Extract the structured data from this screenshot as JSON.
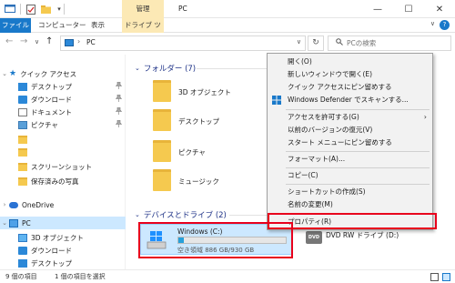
{
  "titlebar": {
    "manage_label": "管理",
    "title": "PC",
    "minimize": "—",
    "maximize": "☐",
    "close": "✕"
  },
  "ribbon": {
    "tabs": [
      "ファイル",
      "コンピューター",
      "表示",
      "ドライブ ツール"
    ],
    "help": "?",
    "expand": "∨"
  },
  "address": {
    "back": "←",
    "forward": "→",
    "recent": "∨",
    "up": "↑",
    "separator": "›",
    "path": "PC",
    "dropdown": "∨",
    "refresh": "↻",
    "search_placeholder": "PCの検索"
  },
  "sidebar": {
    "quick_access": "クイック アクセス",
    "items": [
      {
        "label": "デスクトップ",
        "pinned": true
      },
      {
        "label": "ダウンロード",
        "pinned": true
      },
      {
        "label": "ドキュメント",
        "pinned": true
      },
      {
        "label": "ピクチャ",
        "pinned": true
      },
      {
        "label": "",
        "pinned": false
      },
      {
        "label": "",
        "pinned": false
      },
      {
        "label": "スクリーンショット",
        "pinned": false
      },
      {
        "label": "保存済みの写真",
        "pinned": false
      }
    ],
    "onedrive": "OneDrive",
    "pc": "PC",
    "pc_children": [
      "3D オブジェクト",
      "ダウンロード",
      "デスクトップ"
    ],
    "pin_glyph": "📌"
  },
  "main": {
    "folders_header": "フォルダー (7)",
    "folders": [
      "3D オブジェクト",
      "デスクトップ",
      "ピクチャ",
      "ミュージック"
    ],
    "devices_header": "デバイスとドライブ (2)",
    "drive_c": {
      "name": "Windows (C:)",
      "free": "空き領域 886 GB/930 GB",
      "used_fraction": 0.047
    },
    "dvd": {
      "name": "DVD RW ドライブ (D:)",
      "badge": "DVD"
    }
  },
  "context_menu": {
    "items": [
      "開く(O)",
      "新しいウィンドウで開く(E)",
      "クイック アクセスにピン留めする",
      "Windows Defender でスキャンする...",
      "アクセスを許可する(G)",
      "以前のバージョンの復元(V)",
      "スタート メニューにピン留めする",
      "フォーマット(A)...",
      "コピー(C)",
      "ショートカットの作成(S)",
      "名前の変更(M)",
      "プロパティ(R)"
    ],
    "submenu_arrow": "›"
  },
  "statusbar": {
    "count": "9 個の項目",
    "selected": "1 個の項目を選択"
  },
  "colors": {
    "accent": "#1979ca",
    "selection": "#cce8ff",
    "highlight": "#e8001c",
    "manage_tab": "#fce9b5"
  }
}
